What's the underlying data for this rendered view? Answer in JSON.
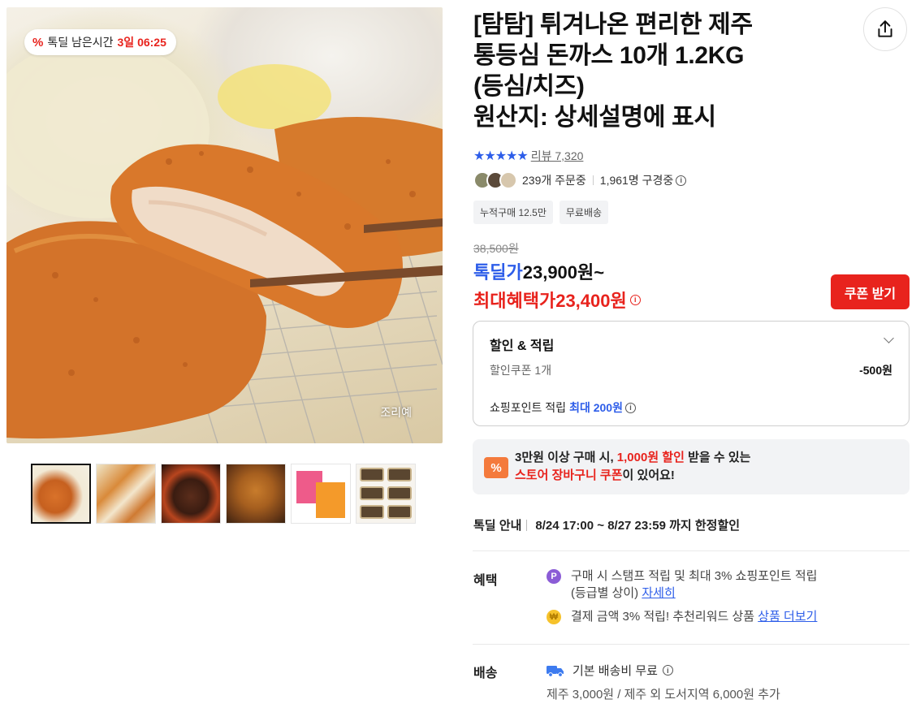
{
  "image": {
    "deal_badge_icon": "percent-icon",
    "deal_badge_label": "톡딜 남은시간",
    "deal_badge_time": "3일 06:25",
    "caption": "조리예"
  },
  "thumbnails": [
    {
      "name": "cutlet-closeup"
    },
    {
      "name": "cutlet-slices"
    },
    {
      "name": "grilled-patty"
    },
    {
      "name": "fried-bites"
    },
    {
      "name": "package-boxes"
    },
    {
      "name": "tray-packs"
    }
  ],
  "product": {
    "title_line1": "[탐탐] 튀겨나온 편리한 제주",
    "title_line2": "통등심 돈까스 10개 1.2KG",
    "title_line3": "(등심/치즈)",
    "title_line4": "원산지: 상세설명에 표시"
  },
  "rating": {
    "stars": "★★★★★",
    "review_text": "리뷰 7,320"
  },
  "orders": {
    "ordering": "239개 주문중",
    "browsing": "1,961명 구경중"
  },
  "tags": [
    "누적구매 12.5만",
    "무료배송"
  ],
  "price": {
    "original": "38,500원",
    "deal_label": "톡딜가",
    "deal_value": "23,900원~",
    "max_label": "최대혜택가",
    "max_value": "23,400원",
    "coupon_button": "쿠폰 받기"
  },
  "discount": {
    "title": "할인 & 적립",
    "coupon_label": "할인쿠폰 1개",
    "coupon_amount": "-500원",
    "point_label": "쇼핑포인트 적립",
    "point_value": "최대 200원"
  },
  "store_coupon": {
    "icon": "%",
    "text_part1": "3만원 이상 구매 시,",
    "text_red1": "1,000원 할인",
    "text_part2": "받을 수 있는",
    "text_red2": "스토어 장바구니 쿠폰",
    "text_part3": "이 있어요!"
  },
  "deal_info": {
    "label": "톡딜 안내",
    "period": "8/24 17:00 ~ 8/27 23:59 까지 한정할인"
  },
  "benefits": {
    "label": "혜택",
    "line1": "구매 시 스탬프 적립 및 최대 3% 쇼핑포인트 적립",
    "line1b": "(등급별 상이)",
    "line1_link": "자세히",
    "line2": "결제 금액 3% 적립! 추천리워드 상품",
    "line2_link": "상품 더보기"
  },
  "shipping": {
    "label": "배송",
    "fee": "기본 배송비 무료",
    "extra": "제주 3,000원 / 제주 외 도서지역 6,000원 추가"
  },
  "colors": {
    "accent_blue": "#2d5de9",
    "accent_red": "#e8231d",
    "coupon_orange": "#f47a3c"
  }
}
